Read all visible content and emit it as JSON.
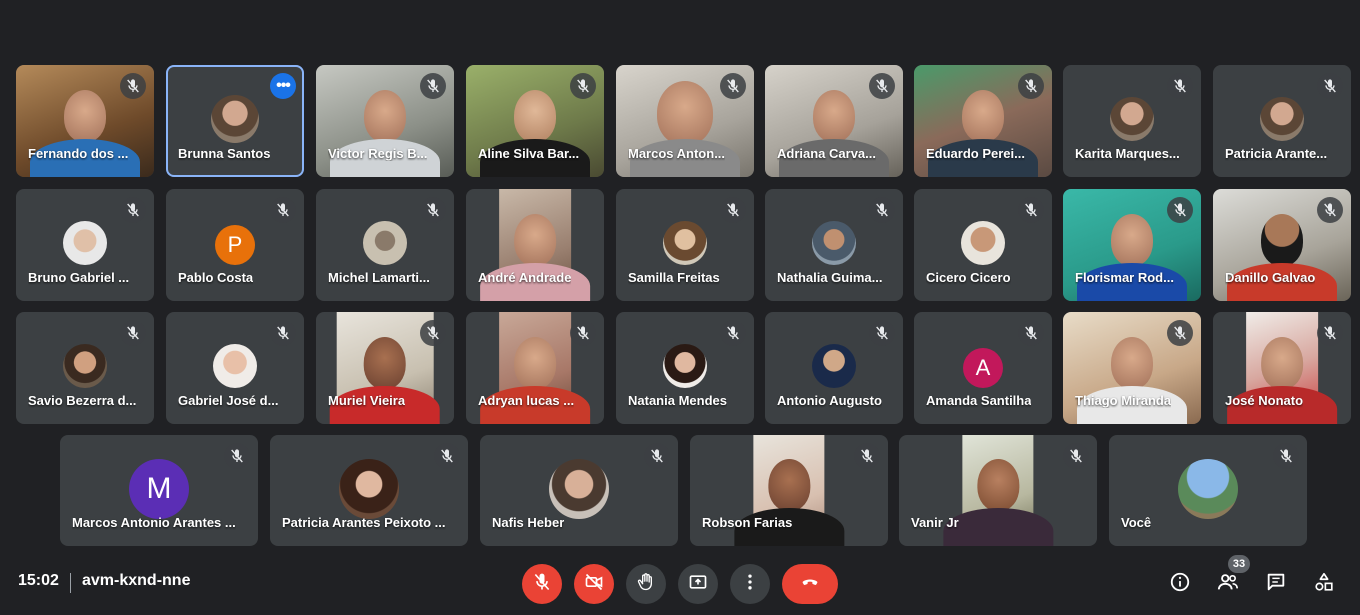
{
  "participants_row1": [
    {
      "name": "Fernando dos ..."
    },
    {
      "name": "Brunna Santos"
    },
    {
      "name": "Victor Regis B..."
    },
    {
      "name": "Aline Silva Bar..."
    },
    {
      "name": "Marcos Anton..."
    },
    {
      "name": "Adriana Carva..."
    },
    {
      "name": "Eduardo Perei..."
    },
    {
      "name": "Karita Marques..."
    },
    {
      "name": "Patricia Arante..."
    }
  ],
  "participants_row2": [
    {
      "name": "Bruno Gabriel ..."
    },
    {
      "name": "Pablo Costa",
      "initial": "P"
    },
    {
      "name": "Michel Lamarti..."
    },
    {
      "name": "André Andrade"
    },
    {
      "name": "Samilla Freitas"
    },
    {
      "name": "Nathalia Guima..."
    },
    {
      "name": "Cicero Cicero"
    },
    {
      "name": "Florismar Rod..."
    },
    {
      "name": "Danillo Galvao"
    }
  ],
  "participants_row3": [
    {
      "name": "Savio Bezerra d..."
    },
    {
      "name": "Gabriel José d..."
    },
    {
      "name": "Muriel Vieira"
    },
    {
      "name": "Adryan lucas ..."
    },
    {
      "name": "Natania Mendes"
    },
    {
      "name": "Antonio Augusto"
    },
    {
      "name": "Amanda Santilha",
      "initial": "A"
    },
    {
      "name": "Thiago Miranda"
    },
    {
      "name": "José Nonato"
    }
  ],
  "participants_row4": [
    {
      "name": "Marcos Antonio Arantes ...",
      "initial": "M"
    },
    {
      "name": "Patricia Arantes Peixoto ..."
    },
    {
      "name": "Nafis Heber"
    },
    {
      "name": "Robson Farias"
    },
    {
      "name": "Vanir Jr"
    },
    {
      "name": "Você"
    }
  ],
  "tile_menu_icon": "more-horiz-icon",
  "meeting": {
    "time": "15:02",
    "code": "avm-kxnd-nne"
  },
  "participant_count": "33",
  "controls": {
    "mic": "mic-off-icon",
    "camera": "videocam-off-icon",
    "raise_hand": "hand-icon",
    "present": "present-screen-icon",
    "more": "more-vert-icon",
    "leave": "call-end-icon"
  },
  "right_icons": [
    "info-icon",
    "people-icon",
    "chat-icon",
    "activities-icon"
  ],
  "colors": {
    "background": "#202124",
    "tile": "#3c4043",
    "red": "#ea4335",
    "highlight": "#8ab4f8",
    "pablo": "#e8710a",
    "amanda": "#c2185b",
    "marcos": "#5b2eb5"
  }
}
